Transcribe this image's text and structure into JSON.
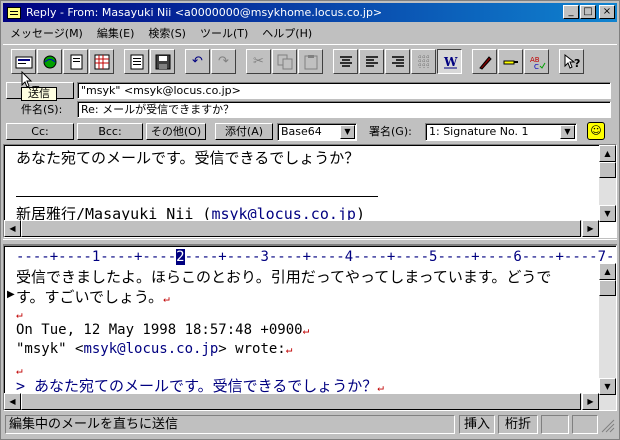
{
  "window": {
    "title": "Reply - From: Masayuki Nii <a0000000@msykhome.locus.co.jp>",
    "minimize": "_",
    "maximize": "□",
    "close": "×"
  },
  "menu": [
    "メッセージ(M)",
    "編集(E)",
    "検索(S)",
    "ツール(T)",
    "ヘルプ(H)"
  ],
  "toolbar": {
    "tooltip": "送信"
  },
  "header": {
    "to_button": "To:",
    "to_value": "\"msyk\" <msyk@locus.co.jp>",
    "subject_label": "件名(S):",
    "subject_value": "Re: メールが受信できますか？",
    "cc_button": "Cc:",
    "bcc_button": "Bcc:",
    "other_button": "その他(O)",
    "attach_button": "添付(A)",
    "encoding_value": "Base64",
    "signature_label": "署名(G):",
    "signature_value": "1: Signature No. 1"
  },
  "original": {
    "line1": "あなた宛てのメールです。受信できるでしょうか？",
    "sig_name": "新居雅行/Masayuki Nii (",
    "sig_email": "msyk@locus.co.jp",
    "sig_close": ")"
  },
  "editor": {
    "ruler_pre": "----+----1----+----",
    "ruler_caret": "2",
    "ruler_post": "----+----3----+----4----+----5----+----6----+----7--",
    "line1": "受信できましたよ。ほらこのとおり。引用だってやってしまっています。どうで",
    "line2": "す。すごいでしょう。",
    "line4": "On Tue, 12 May 1998 18:57:48 +0900",
    "line5_pre": "\"msyk\" <",
    "line5_email": "msyk@locus.co.jp",
    "line5_post": "> wrote:",
    "line7": "> あなた宛てのメールです。受信できるでしょうか？",
    "return_mark": "↵"
  },
  "status": {
    "message": "編集中のメールを直ちに送信",
    "insert": "挿入",
    "wrap": "桁折"
  }
}
